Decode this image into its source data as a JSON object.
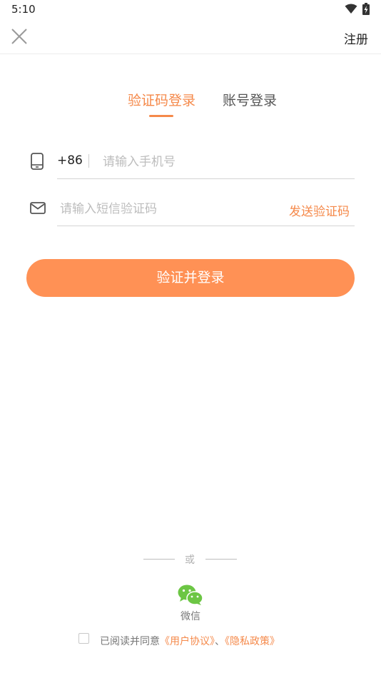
{
  "status_bar": {
    "time": "5:10"
  },
  "header": {
    "register_label": "注册"
  },
  "tabs": [
    {
      "label": "验证码登录",
      "active": true
    },
    {
      "label": "账号登录",
      "active": false
    }
  ],
  "phone_field": {
    "country_code": "+86",
    "value": "",
    "placeholder": "请输入手机号"
  },
  "code_field": {
    "value": "",
    "placeholder": "请输入短信验证码",
    "send_code_label": "发送验证码"
  },
  "login_button_label": "验证并登录",
  "alternative": {
    "or_text": "或",
    "wechat_label": "微信"
  },
  "agreement": {
    "prefix": "已阅读并同意",
    "user_agreement": "《用户协议》",
    "separator": "、",
    "privacy_policy": "《隐私政策》"
  },
  "colors": {
    "accent": "#f5894a",
    "button": "#ff9155",
    "wechat": "#6cc644"
  }
}
